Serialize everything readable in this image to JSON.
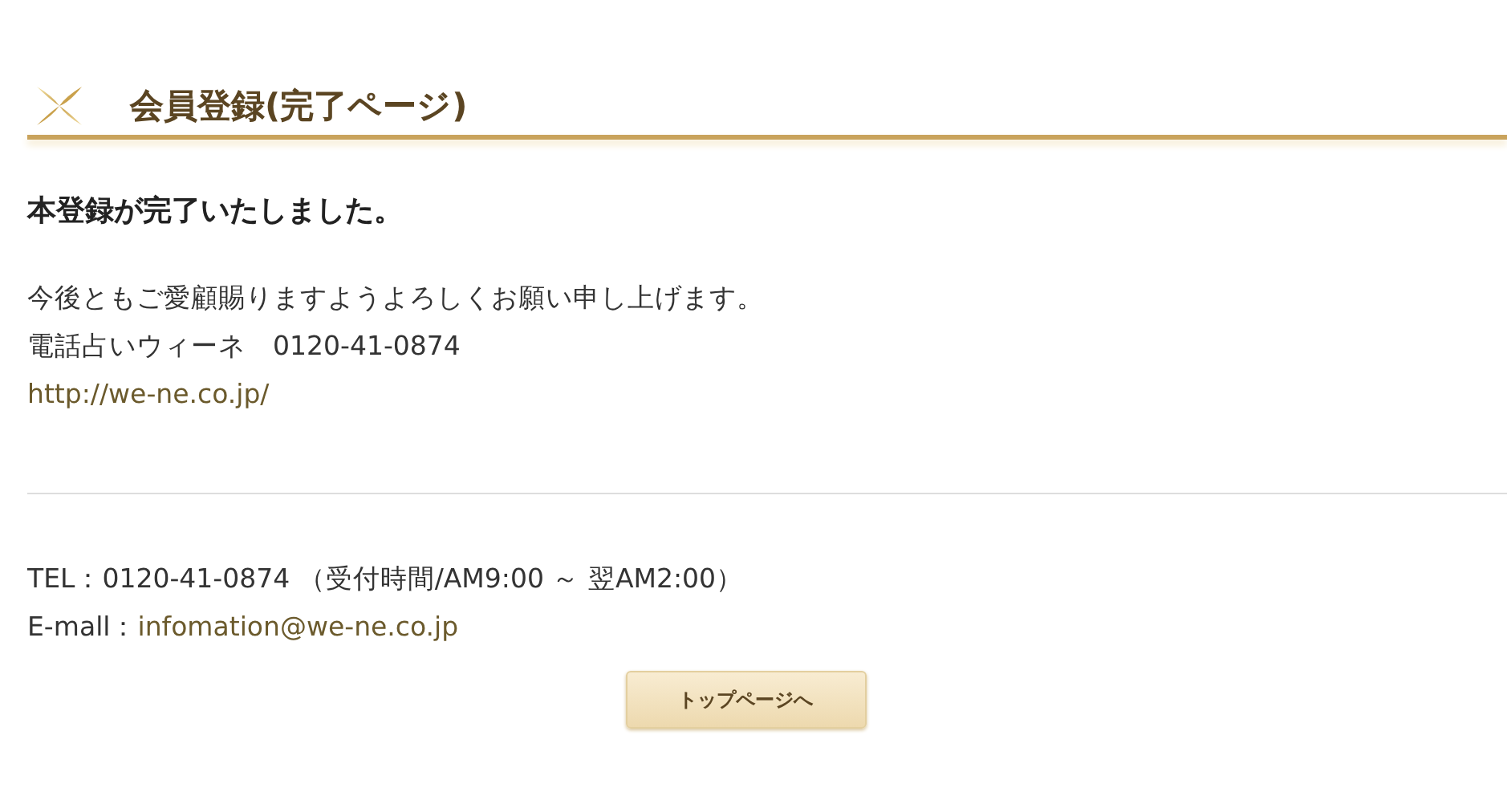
{
  "heading": {
    "title": "会員登録(完了ページ)"
  },
  "message": {
    "title": "本登録が完了いたしました。",
    "lines": [
      "今後ともご愛顧賜りますようよろしくお願い申し上げます。",
      "電話占いウィーネ　0120-41-0874"
    ],
    "link": "http://we-ne.co.jp/"
  },
  "footer": {
    "tel_label": "TEL：",
    "tel": "0120-41-0874 （受付時間/AM9:00 ～ 翌AM2:00）",
    "email_label": "E-mall：",
    "email": "infomation@we-ne.co.jp"
  },
  "button": "トップページへ"
}
